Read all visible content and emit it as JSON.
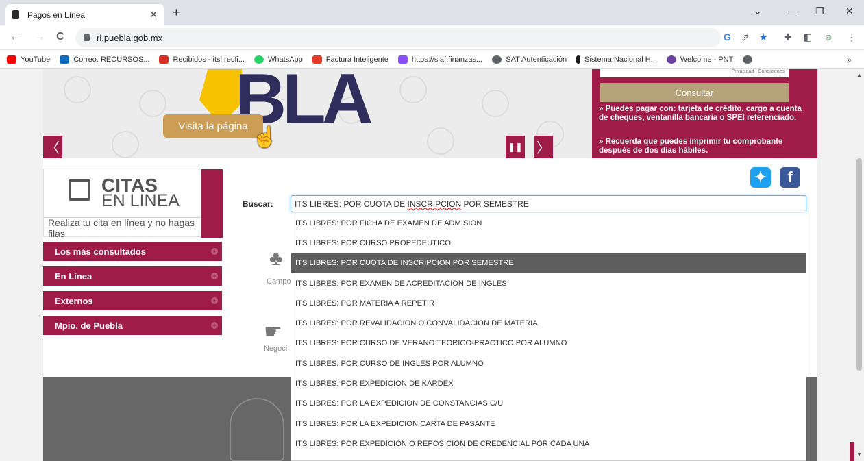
{
  "browser": {
    "tab_title": "Pagos en Línea",
    "tab_close": "✕",
    "new_tab": "+",
    "url": "rl.puebla.gob.mx",
    "back": "←",
    "forward": "→",
    "reload": "C",
    "bookmarks": [
      {
        "label": "YouTube",
        "color": "#ff0000"
      },
      {
        "label": "Correo: RECURSOS...",
        "color": "#0f6cbd"
      },
      {
        "label": "Recibidos - itsl.recfi...",
        "color": "#d93025"
      },
      {
        "label": "WhatsApp",
        "color": "#25d366"
      },
      {
        "label": "Factura Inteligente",
        "color": "#e33a25"
      },
      {
        "label": "https://siaf.finanzas...",
        "color": "#8a4fff"
      },
      {
        "label": "SAT Autenticación",
        "color": "#5f6368"
      },
      {
        "label": "Sistema Nacional H...",
        "color": "#1a1a1a"
      },
      {
        "label": "Welcome - PNT",
        "color": "#6d3fa0"
      }
    ],
    "bookmarks_more": "»"
  },
  "banner": {
    "logo_text": "BLA",
    "visit_button": "Visita la página",
    "prev_arrow": "〈",
    "next_arrow": "〉",
    "pause": "❚❚"
  },
  "payment_panel": {
    "recaptcha_text": "Privacidad - Condiciones",
    "consult_button": "Consultar",
    "info1": "» Puedes pagar con: tarjeta de crédito, cargo a cuenta de cheques, ventanilla bancaria o SPEI referenciado.",
    "info2": "» Recuerda que puedes imprimir tu comprobante después de dos días hábiles."
  },
  "citas": {
    "title1": "CITAS",
    "title2": "EN LINEA",
    "subtitle": "Realiza tu cita en línea y no hagas filas"
  },
  "menu": [
    {
      "label": "Los más consultados"
    },
    {
      "label": "En Línea"
    },
    {
      "label": "Externos"
    },
    {
      "label": "Mpio. de Puebla"
    }
  ],
  "search": {
    "label": "Buscar:",
    "value_prefix": "ITS LIBRES: POR CUOTA DE ",
    "value_misspelled": "INSCRIPCION",
    "value_suffix": " POR SEMESTRE"
  },
  "background_links": {
    "campo": "Campo",
    "negocio": "Negoci"
  },
  "dropdown": {
    "selected_index": 2,
    "items": [
      "ITS LIBRES: POR FICHA DE EXAMEN DE ADMISION",
      "ITS LIBRES: POR CURSO PROPEDEUTICO",
      "ITS LIBRES: POR CUOTA DE INSCRIPCION POR SEMESTRE",
      "ITS LIBRES: POR EXAMEN DE ACREDITACION DE INGLES",
      "ITS LIBRES: POR MATERIA A REPETIR",
      "ITS LIBRES: POR REVALIDACION O CONVALIDACION DE MATERIA",
      "ITS LIBRES: POR CURSO DE VERANO TEORICO-PRACTICO POR ALUMNO",
      "ITS LIBRES: POR CURSO DE INGLES POR ALUMNO",
      "ITS LIBRES: POR EXPEDICION DE KARDEX",
      "ITS LIBRES: POR LA EXPEDICION DE CONSTANCIAS C/U",
      "ITS LIBRES: POR LA EXPEDICION CARTA DE PASANTE",
      "ITS LIBRES: POR EXPEDICION O REPOSICION DE CREDENCIAL POR CADA UNA"
    ]
  },
  "colors": {
    "brand": "#9f1c48",
    "gold": "#b4a278",
    "selected": "#5e5e5e"
  }
}
